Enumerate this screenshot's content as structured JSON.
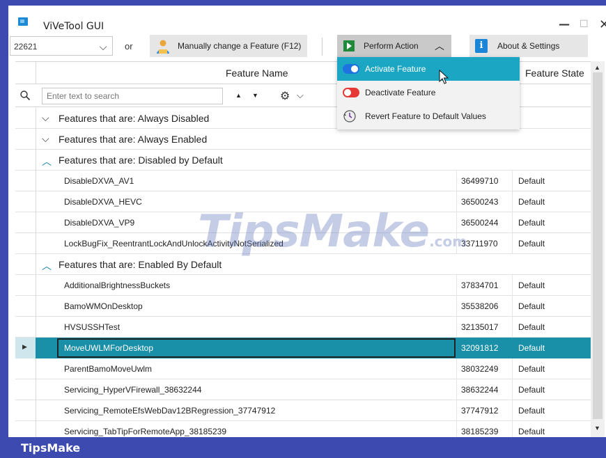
{
  "window": {
    "title": "ViVeTool GUI",
    "minimize_glyph": "—",
    "maximize_glyph": "☐",
    "close_glyph": "✕"
  },
  "toolbar": {
    "build_value": "22621",
    "or_label": "or",
    "manual_label": "Manually change a Feature (F12)",
    "perform_label": "Perform Action",
    "about_label": "About & Settings"
  },
  "perform_menu": {
    "items": [
      {
        "label": "Activate Feature",
        "icon": "toggle-on-icon"
      },
      {
        "label": "Deactivate Feature",
        "icon": "toggle-off-icon"
      },
      {
        "label": "Revert Feature to Default Values",
        "icon": "revert-clock-icon"
      }
    ]
  },
  "grid": {
    "columns": {
      "name": "Feature Name",
      "id": "",
      "state": "Feature State"
    },
    "search_placeholder": "Enter text to search",
    "groups": [
      {
        "label": "Features that are: Always Disabled",
        "expanded": false,
        "rows": []
      },
      {
        "label": "Features that are: Always Enabled",
        "expanded": false,
        "rows": []
      },
      {
        "label": "Features that are: Disabled by Default",
        "expanded": true,
        "rows": [
          {
            "name": "DisableDXVA_AV1",
            "id": "36499710",
            "state": "Default"
          },
          {
            "name": "DisableDXVA_HEVC",
            "id": "36500243",
            "state": "Default"
          },
          {
            "name": "DisableDXVA_VP9",
            "id": "36500244",
            "state": "Default"
          },
          {
            "name": "LockBugFix_ReentrantLockAndUnlockActivityNotSerialized",
            "id": "33711970",
            "state": "Default"
          }
        ]
      },
      {
        "label": "Features that are: Enabled By Default",
        "expanded": true,
        "rows": [
          {
            "name": "AdditionalBrightnessBuckets",
            "id": "37834701",
            "state": "Default"
          },
          {
            "name": "BamoWMOnDesktop",
            "id": "35538206",
            "state": "Default"
          },
          {
            "name": "HVSUSSHTest",
            "id": "32135017",
            "state": "Default"
          },
          {
            "name": "MoveUWLMForDesktop",
            "id": "32091812",
            "state": "Default",
            "selected": true
          },
          {
            "name": "ParentBamoMoveUwlm",
            "id": "38032249",
            "state": "Default"
          },
          {
            "name": "Servicing_HyperVFirewall_38632244",
            "id": "38632244",
            "state": "Default"
          },
          {
            "name": "Servicing_RemoteEfsWebDav12BRegression_37747912",
            "id": "37747912",
            "state": "Default"
          },
          {
            "name": "Servicing_TabTipForRemoteApp_38185239",
            "id": "38185239",
            "state": "Default"
          }
        ]
      }
    ]
  },
  "watermark": {
    "main": "TipsMake",
    "suffix": ".com"
  },
  "footer": {
    "brand": "TipsMake"
  },
  "colors": {
    "frame": "#3d4bb0",
    "selection": "#1a8fa8",
    "menu_hover": "#1ba6c4",
    "toggle_on": "#1e73e0",
    "toggle_off": "#e53935"
  }
}
